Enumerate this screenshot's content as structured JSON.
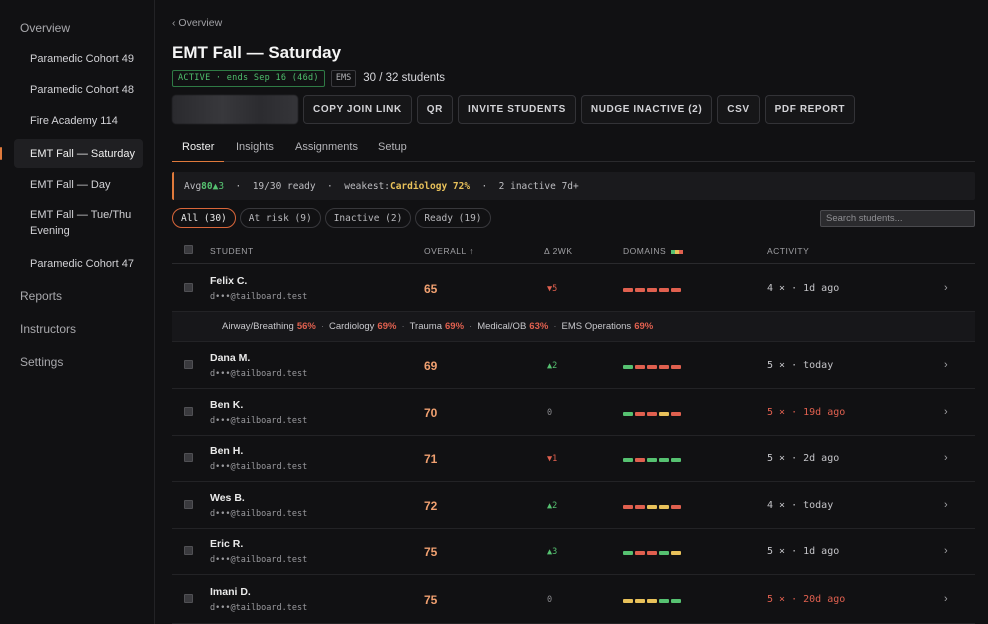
{
  "sidebar": {
    "overview": "Overview",
    "cohorts": [
      {
        "label": "Paramedic Cohort 49"
      },
      {
        "label": "Paramedic Cohort 48"
      },
      {
        "label": "Fire Academy 114"
      },
      {
        "label": "EMT Fall — Saturday",
        "active": true
      },
      {
        "label": "EMT Fall — Day"
      },
      {
        "label": "EMT Fall — Tue/Thu Evening"
      },
      {
        "label": "Paramedic Cohort 47"
      }
    ],
    "reports": "Reports",
    "instructors": "Instructors",
    "settings": "Settings"
  },
  "header": {
    "breadcrumb": "‹ Overview",
    "title": "EMT Fall — Saturday",
    "status_badge": "ACTIVE · ends Sep 16 (46d)",
    "type_badge": "EMS",
    "students": "30 / 32 students"
  },
  "actions": {
    "copy_join_link": "COPY JOIN LINK",
    "qr": "QR",
    "invite_students": "INVITE STUDENTS",
    "nudge_inactive": "NUDGE INACTIVE (2)",
    "csv": "CSV",
    "pdf_report": "PDF REPORT"
  },
  "tabs": [
    "Roster",
    "Insights",
    "Assignments",
    "Setup"
  ],
  "summary": {
    "avg_label": "Avg",
    "avg_value": "80",
    "avg_delta": "▲3",
    "ready": "19/30 ready",
    "weakest_label": "weakest:",
    "weakest_value": "Cardiology 72%",
    "inactive": "2 inactive 7d+"
  },
  "filters": [
    "All (30)",
    "At risk (9)",
    "Inactive (2)",
    "Ready (19)"
  ],
  "search": {
    "placeholder": "Search students..."
  },
  "table": {
    "columns": {
      "student": "STUDENT",
      "overall": "OVERALL ↑",
      "delta": "Δ 2WK",
      "domains": "DOMAINS",
      "activity": "ACTIVITY"
    },
    "rows": [
      {
        "name": "Felix C.",
        "email": "d•••@tailboard.test",
        "overall": "65",
        "delta": "▼5",
        "delta_dir": "down",
        "domains": [
          "r",
          "r",
          "r",
          "r",
          "r"
        ],
        "activity": "4 × · 1d ago",
        "activity_alert": false
      },
      {
        "name": "Dana M.",
        "email": "d•••@tailboard.test",
        "overall": "69",
        "delta": "▲2",
        "delta_dir": "up",
        "domains": [
          "g",
          "r",
          "r",
          "r",
          "r"
        ],
        "activity": "5 × · today",
        "activity_alert": false
      },
      {
        "name": "Ben K.",
        "email": "d•••@tailboard.test",
        "overall": "70",
        "delta": "0",
        "delta_dir": "flat",
        "domains": [
          "g",
          "r",
          "r",
          "y",
          "r"
        ],
        "activity": "5 × · 19d ago",
        "activity_alert": true
      },
      {
        "name": "Ben H.",
        "email": "d•••@tailboard.test",
        "overall": "71",
        "delta": "▼1",
        "delta_dir": "down",
        "domains": [
          "g",
          "r",
          "g",
          "g",
          "g"
        ],
        "activity": "5 × · 2d ago",
        "activity_alert": false
      },
      {
        "name": "Wes B.",
        "email": "d•••@tailboard.test",
        "overall": "72",
        "delta": "▲2",
        "delta_dir": "up",
        "domains": [
          "r",
          "r",
          "y",
          "y",
          "r"
        ],
        "activity": "4 × · today",
        "activity_alert": false
      },
      {
        "name": "Eric R.",
        "email": "d•••@tailboard.test",
        "overall": "75",
        "delta": "▲3",
        "delta_dir": "up",
        "domains": [
          "g",
          "r",
          "r",
          "g",
          "y"
        ],
        "activity": "5 × · 1d ago",
        "activity_alert": false
      },
      {
        "name": "Imani D.",
        "email": "d•••@tailboard.test",
        "overall": "75",
        "delta": "0",
        "delta_dir": "flat",
        "domains": [
          "y",
          "y",
          "y",
          "g",
          "g"
        ],
        "activity": "5 × · 20d ago",
        "activity_alert": true
      }
    ],
    "expanded": [
      {
        "label": "Airway/Breathing",
        "pct": "56%"
      },
      {
        "label": "Cardiology",
        "pct": "69%"
      },
      {
        "label": "Trauma",
        "pct": "69%"
      },
      {
        "label": "Medical/OB",
        "pct": "63%"
      },
      {
        "label": "EMS Operations",
        "pct": "69%"
      }
    ]
  },
  "colors": {
    "accent": "#e07a3c",
    "green": "#56c271",
    "red": "#e0604f",
    "yellow": "#e8c15a"
  }
}
